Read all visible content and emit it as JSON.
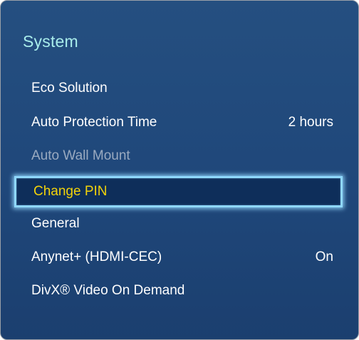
{
  "menu": {
    "title": "System",
    "items": [
      {
        "label": "Eco Solution",
        "value": ""
      },
      {
        "label": "Auto Protection Time",
        "value": "2 hours"
      },
      {
        "label": "Auto Wall Mount",
        "value": ""
      },
      {
        "label": "Change PIN",
        "value": ""
      },
      {
        "label": "General",
        "value": ""
      },
      {
        "label": "Anynet+ (HDMI-CEC)",
        "value": "On"
      },
      {
        "label": "DivX® Video On Demand",
        "value": ""
      }
    ]
  },
  "colors": {
    "background": "#1f477a",
    "title": "#a8ecea",
    "selected_text": "#f2d20a",
    "highlight_border": "#8fd8ff"
  }
}
